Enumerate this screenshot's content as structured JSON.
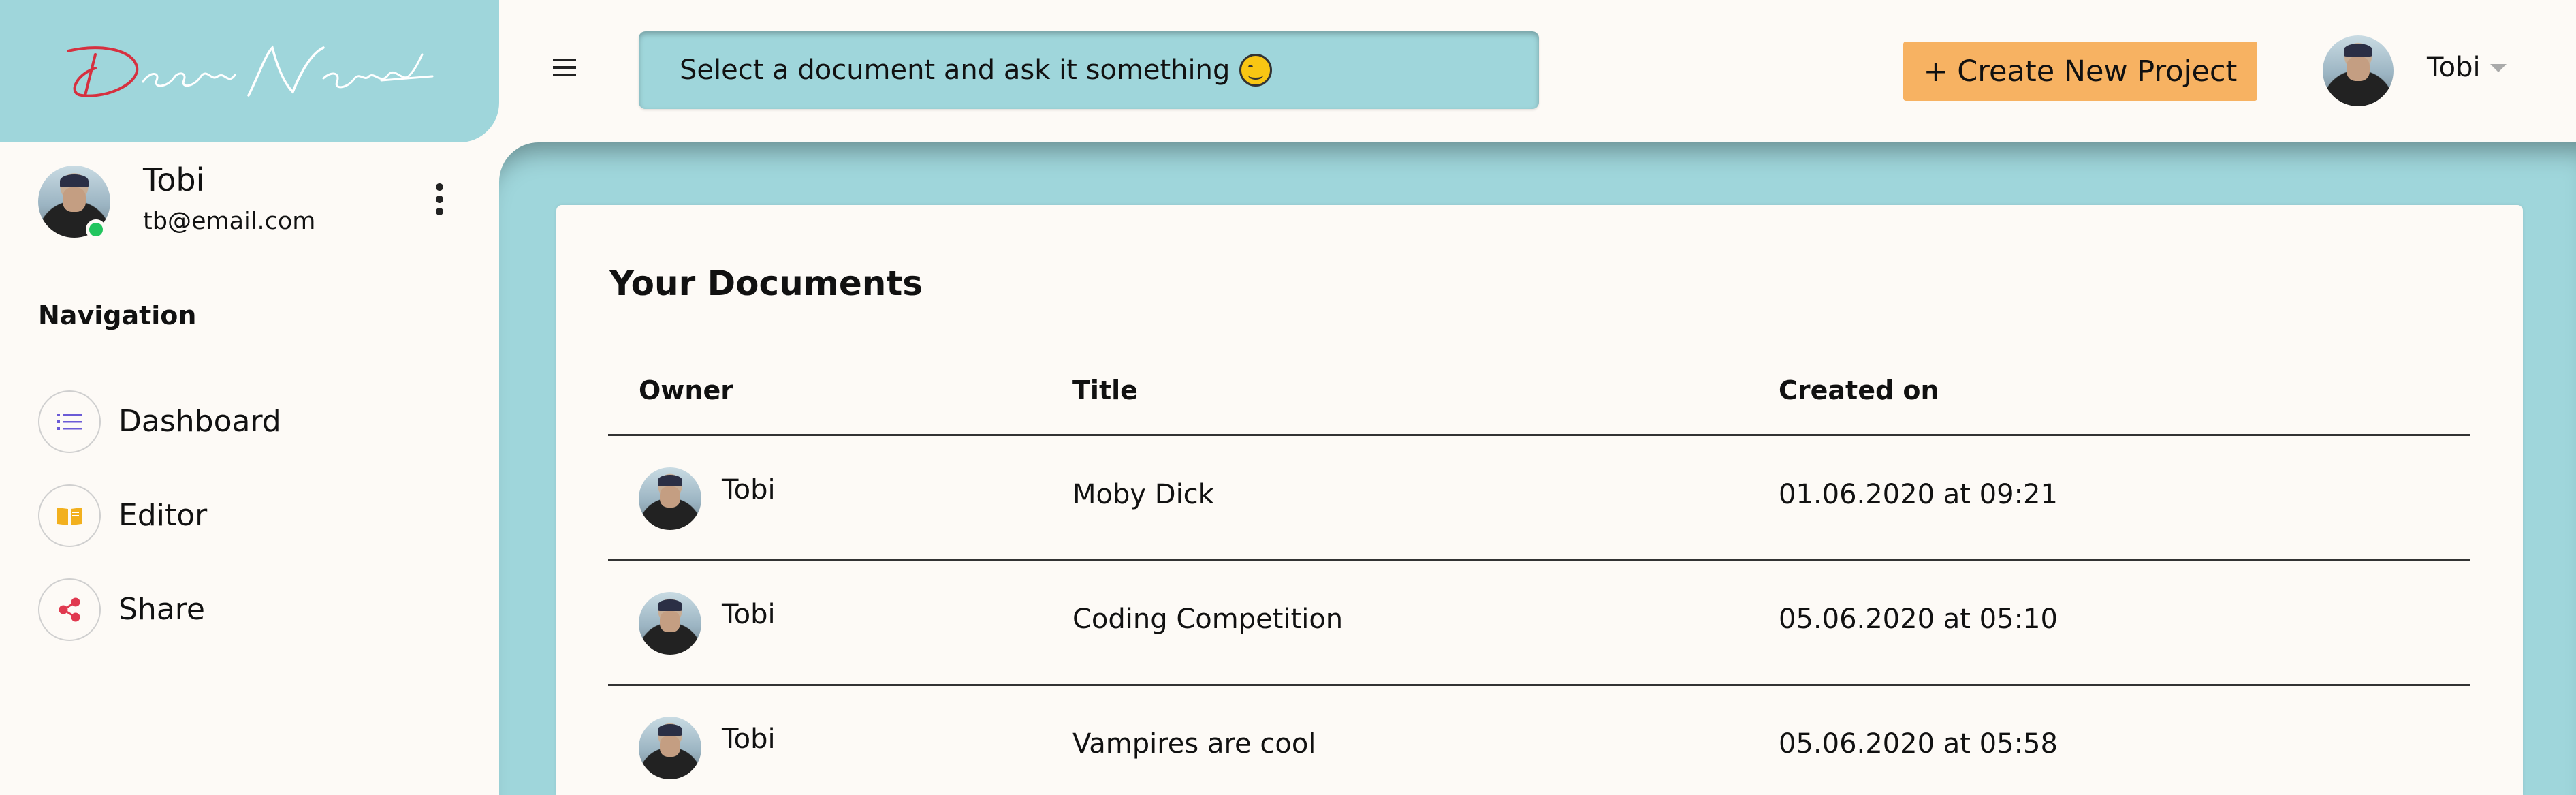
{
  "brand": {
    "logo_text": "DeepNovel"
  },
  "search": {
    "text": "Select a document and ask it something"
  },
  "header": {
    "create_button": "+ Create New Project",
    "user_name": "Tobi"
  },
  "sidebar": {
    "user": {
      "name": "Tobi",
      "email": "tb@email.com"
    },
    "nav_title": "Navigation",
    "items": [
      {
        "label": "Dashboard",
        "icon": "list-icon",
        "color": "#6b5bd6"
      },
      {
        "label": "Editor",
        "icon": "book-icon",
        "color": "#f2b01e"
      },
      {
        "label": "Share",
        "icon": "share-icon",
        "color": "#e0394f"
      }
    ]
  },
  "documents": {
    "title": "Your Documents",
    "columns": [
      "Owner",
      "Title",
      "Created on"
    ],
    "rows": [
      {
        "owner": "Tobi",
        "title": "Moby Dick",
        "created": "01.06.2020 at 09:21"
      },
      {
        "owner": "Tobi",
        "title": "Coding Competition",
        "created": "05.06.2020 at 05:10"
      },
      {
        "owner": "Tobi",
        "title": "Vampires are cool",
        "created": "05.06.2020 at 05:58"
      }
    ]
  },
  "colors": {
    "accent": "#9fd6db",
    "button": "#f7b262",
    "background": "#fdfaf6",
    "online": "#22c55e"
  }
}
